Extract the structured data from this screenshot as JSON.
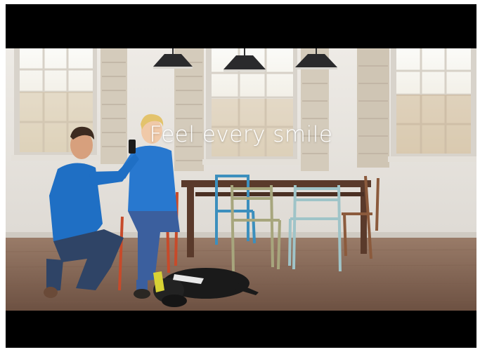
{
  "video": {
    "caption": "Feel every smile"
  },
  "scene": {
    "subjects": [
      "man-kneeling",
      "woman-seated",
      "black-dog-lying"
    ],
    "colors": {
      "wall": "#e9e6e1",
      "floor": "#8a6a57",
      "shirts": "#1f73c9"
    }
  }
}
